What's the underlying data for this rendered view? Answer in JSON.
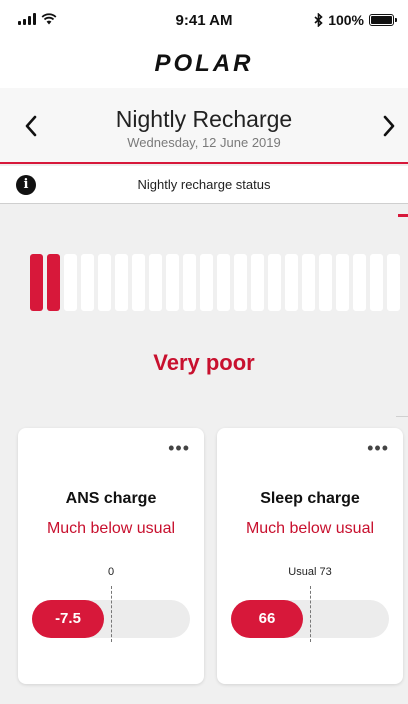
{
  "status_bar": {
    "time": "9:41 AM",
    "battery": "100%"
  },
  "brand": {
    "logo_text": "POLAR"
  },
  "header": {
    "title": "Nightly Recharge",
    "date": "Wednesday, 12 June 2019"
  },
  "info_bar": {
    "text": "Nightly recharge status",
    "icon": "info-icon"
  },
  "recharge": {
    "status": "Very poor",
    "scale_total": 22,
    "filled": 2
  },
  "cards": [
    {
      "title": "ANS charge",
      "subtitle": "Much below usual",
      "reference": "0",
      "value": "-7.5"
    },
    {
      "title": "Sleep charge",
      "subtitle": "Much below usual",
      "reference": "Usual 73",
      "value": "66"
    }
  ],
  "colors": {
    "accent": "#d7183a",
    "status_text": "#c8102e",
    "background": "#f0f0f0"
  }
}
